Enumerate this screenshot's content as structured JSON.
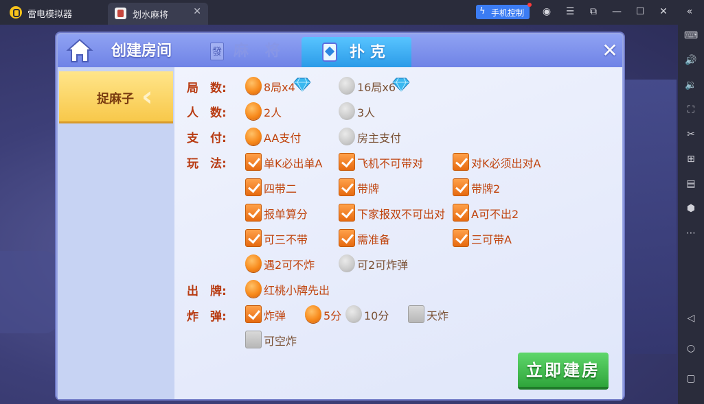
{
  "emulator": {
    "app_name": "雷电模拟器",
    "tab_label": "划水麻将",
    "phone_control": "手机控制"
  },
  "dialog": {
    "tabs": {
      "create_room": "创建房间",
      "mahjong": "麻 将",
      "mahjong_icon": "發",
      "poker": "扑克"
    },
    "left_game": "捉麻子",
    "labels": {
      "rounds": "局　数:",
      "players": "人　数:",
      "payment": "支　付:",
      "play": "玩　法:",
      "lead": "出　牌:",
      "bomb": "炸　弹:"
    },
    "rounds": [
      {
        "label": "8局x4",
        "checked": true
      },
      {
        "label": "16局x6",
        "checked": false
      }
    ],
    "players": [
      {
        "label": "2人",
        "checked": true
      },
      {
        "label": "3人",
        "checked": false
      }
    ],
    "payment": [
      {
        "label": "AA支付",
        "checked": true
      },
      {
        "label": "房主支付",
        "checked": false
      }
    ],
    "play_rules": [
      {
        "label": "单K必出单A",
        "checked": true
      },
      {
        "label": "飞机不可带对",
        "checked": true
      },
      {
        "label": "对K必须出对A",
        "checked": true
      },
      {
        "label": "四带二",
        "checked": true
      },
      {
        "label": "带牌",
        "checked": true
      },
      {
        "label": "带牌2",
        "checked": true
      },
      {
        "label": "报单算分",
        "checked": true
      },
      {
        "label": "下家报双不可出对",
        "checked": true
      },
      {
        "label": "A可不出2",
        "checked": true
      },
      {
        "label": "可三不带",
        "checked": true
      },
      {
        "label": "需准备",
        "checked": true
      },
      {
        "label": "三可带A",
        "checked": true
      }
    ],
    "play_radio": [
      {
        "label": "遇2可不炸",
        "checked": true
      },
      {
        "label": "可2可炸弹",
        "checked": false
      }
    ],
    "lead": [
      {
        "label": "红桃小牌先出",
        "checked": true
      }
    ],
    "bomb": {
      "bomb_check": {
        "label": "炸弹",
        "checked": true
      },
      "score_5": {
        "label": "5分",
        "checked": true
      },
      "score_10": {
        "label": "10分",
        "checked": false
      },
      "tianzha": {
        "label": "天炸",
        "checked": false
      },
      "kongzha": {
        "label": "可空炸",
        "checked": false
      }
    },
    "create_button": "立即建房"
  },
  "colors": {
    "accent_orange": "#f88b1d",
    "label_red": "#b83b12",
    "create_green": "#2fa53b",
    "header_blue": "#6f83e6",
    "selected_yellow": "#f8c84a"
  },
  "icons": [
    "home-icon",
    "close-icon",
    "diamond-icon",
    "poker-card-icon",
    "mahjong-tile-icon"
  ]
}
